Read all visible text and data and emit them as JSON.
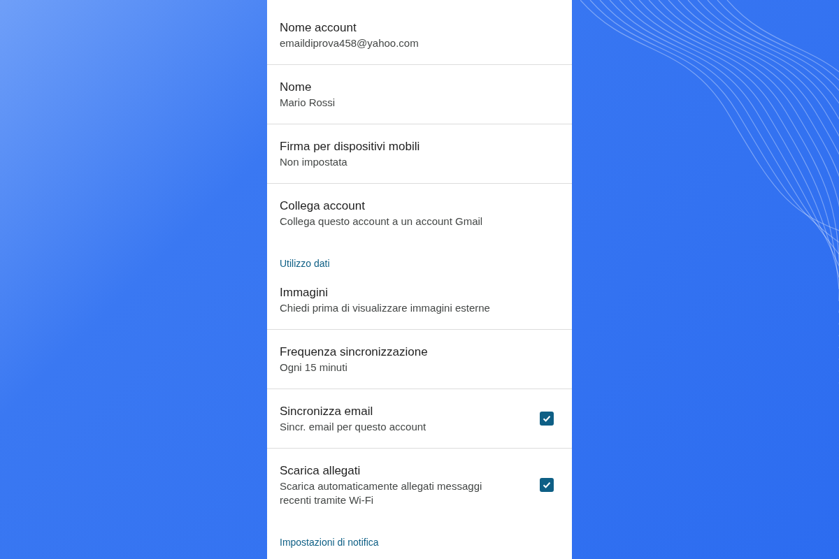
{
  "items": [
    {
      "kind": "setting",
      "title": "Nome account",
      "subtitle": "emaildiprova458@yahoo.com"
    },
    {
      "kind": "setting",
      "title": "Nome",
      "subtitle": "Mario Rossi"
    },
    {
      "kind": "setting",
      "title": "Firma per dispositivi mobili",
      "subtitle": "Non impostata"
    },
    {
      "kind": "setting",
      "title": "Collega account",
      "subtitle": "Collega questo account a un account Gmail",
      "divider": false
    },
    {
      "kind": "header",
      "title": "Utilizzo dati"
    },
    {
      "kind": "setting",
      "title": "Immagini",
      "subtitle": "Chiedi prima di visualizzare immagini esterne"
    },
    {
      "kind": "setting",
      "title": "Frequenza sincronizzazione",
      "subtitle": "Ogni 15 minuti"
    },
    {
      "kind": "checkbox",
      "title": "Sincronizza email",
      "subtitle": "Sincr. email per questo account",
      "checked": true
    },
    {
      "kind": "checkbox",
      "title": "Scarica allegati",
      "subtitle": "Scarica automaticamente allegati messaggi recenti tramite Wi-Fi",
      "checked": true,
      "divider": false
    },
    {
      "kind": "header",
      "title": "Impostazioni di notifica"
    }
  ]
}
